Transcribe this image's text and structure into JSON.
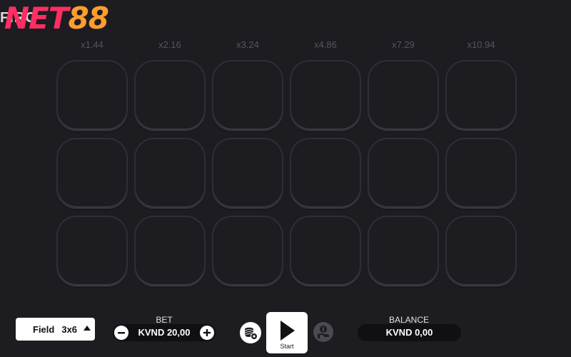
{
  "header": {
    "game_title": "FIRO",
    "logo_prefix": "NET",
    "logo_number": "88"
  },
  "multipliers": [
    "x1.44",
    "x2.16",
    "x3.24",
    "x4.86",
    "x7.29",
    "x10.94"
  ],
  "field": {
    "label": "Field",
    "value": "3x6",
    "caret_icon": "caret-up-icon"
  },
  "bet": {
    "label": "BET",
    "value": "KVND 20,00",
    "minus_icon": "minus-icon",
    "plus_icon": "plus-icon"
  },
  "autobet_icon": "coins-settings-icon",
  "start": {
    "label": "Start",
    "icon": "play-icon"
  },
  "cashout_icon": "hand-coin-icon",
  "balance": {
    "label": "BALANCE",
    "value": "KVND 0,00"
  },
  "colors": {
    "background": "#1c1c21",
    "logo_net": "#ff2e63",
    "logo_88": "#ff9d2e",
    "multiplier_text": "#55555d"
  }
}
